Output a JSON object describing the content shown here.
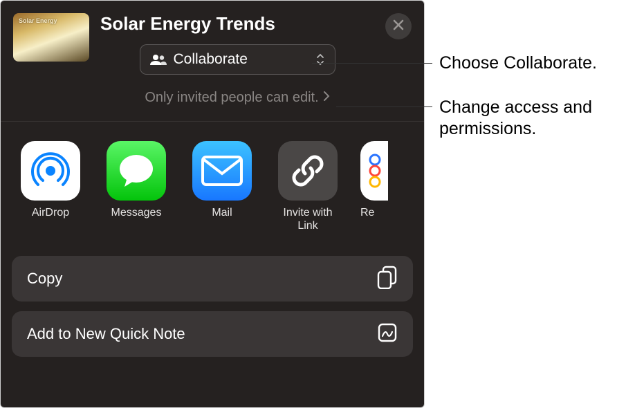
{
  "header": {
    "title": "Solar Energy Trends",
    "thumb_label": "Solar Energy",
    "collab_button_label": "Collaborate",
    "permissions_text": "Only invited people can edit."
  },
  "apps": [
    {
      "id": "airdrop",
      "label": "AirDrop"
    },
    {
      "id": "messages",
      "label": "Messages"
    },
    {
      "id": "mail",
      "label": "Mail"
    },
    {
      "id": "invite",
      "label": "Invite with Link"
    },
    {
      "id": "reminders",
      "label": "Reminders"
    }
  ],
  "actions": {
    "copy": "Copy",
    "quicknote": "Add to New Quick Note"
  },
  "annotations": {
    "collab": "Choose Collaborate.",
    "permissions": "Change access and permissions."
  }
}
